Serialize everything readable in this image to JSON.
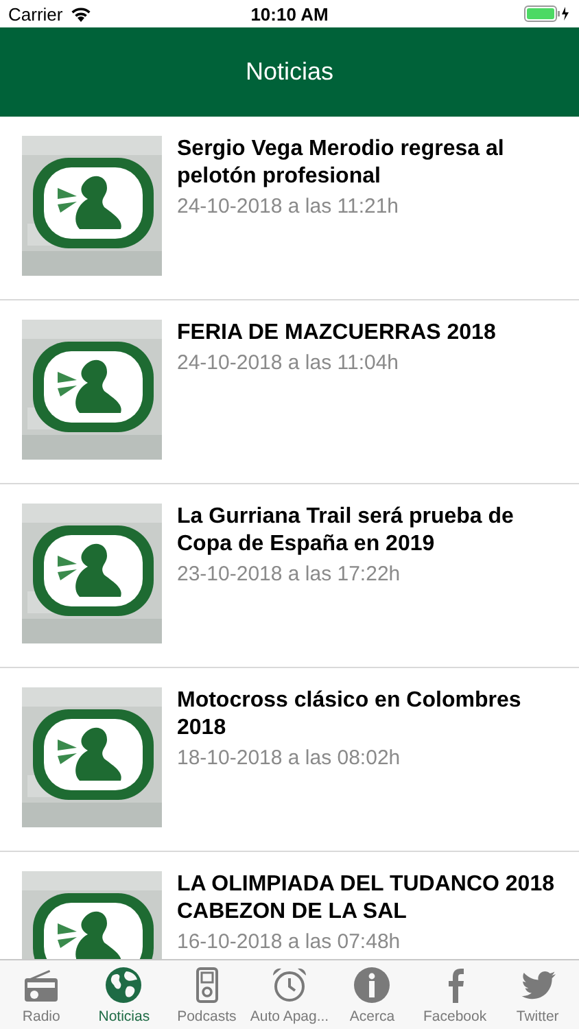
{
  "status_bar": {
    "carrier": "Carrier",
    "time": "10:10 AM"
  },
  "nav_bar": {
    "title": "Noticias"
  },
  "news": [
    {
      "title": "Sergio Vega Merodio regresa al pelotón profesional",
      "date": "24-10-2018 a las 11:21h"
    },
    {
      "title": "FERIA DE MAZCUERRAS 2018",
      "date": "24-10-2018 a las 11:04h"
    },
    {
      "title": "La Gurriana Trail será prueba de Copa de España en 2019",
      "date": "23-10-2018 a las 17:22h"
    },
    {
      "title": "Motocross clásico en Colombres 2018",
      "date": "18-10-2018 a las 08:02h"
    },
    {
      "title": "LA OLIMPIADA DEL TUDANCO 2018 CABEZON DE LA SAL",
      "date": "16-10-2018 a las 07:48h"
    }
  ],
  "tabs": [
    {
      "kind": "radio",
      "label": "Radio",
      "selected": false
    },
    {
      "kind": "globe",
      "label": "Noticias",
      "selected": true
    },
    {
      "kind": "player",
      "label": "Podcasts",
      "selected": false
    },
    {
      "kind": "alarm",
      "label": "Auto Apag...",
      "selected": false
    },
    {
      "kind": "info",
      "label": "Acerca",
      "selected": false
    },
    {
      "kind": "facebook",
      "label": "Facebook",
      "selected": false
    },
    {
      "kind": "twitter",
      "label": "Twitter",
      "selected": false
    }
  ]
}
